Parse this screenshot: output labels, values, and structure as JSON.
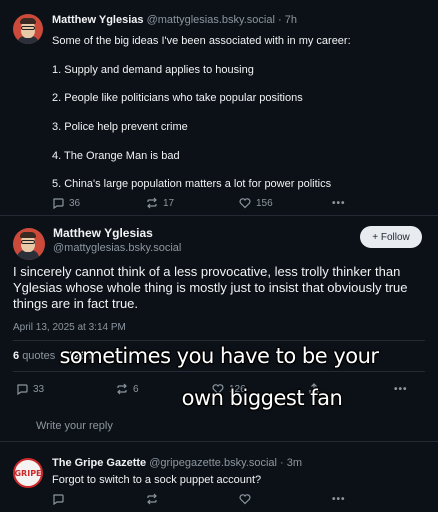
{
  "reply_post": {
    "author_name": "Matthew Yglesias",
    "author_handle": "@mattyglesias.bsky.social",
    "time": "7h",
    "intro": "Some of the big ideas I've been associated with in my career:",
    "items": [
      "1. Supply and demand applies to housing",
      "2. People like politicians who take popular positions",
      "3. Police help prevent crime",
      "4. The Orange Man is bad",
      "5. China's large population matters a lot for power politics"
    ],
    "reply_count": "36",
    "repost_count": "17",
    "like_count": "156",
    "more_label": "•••"
  },
  "main_post": {
    "author_name": "Matthew Yglesias",
    "author_handle": "@mattyglesias.bsky.social",
    "follow_label": "+ Follow",
    "text": "I sincerely cannot think of a less provocative, less trolly thinker than Yglesias whose whole thing is mostly just to insist that obviously true things are in fact true.",
    "date": "April 13, 2025 at 3:14 PM",
    "quotes_count": "6",
    "quotes_label": "quotes",
    "likes_count": "126",
    "likes_label_partial": "li",
    "reply_count": "33",
    "repost_count": "6",
    "like_count": "126",
    "more_label": "•••"
  },
  "meme_caption": {
    "line1": "sometimes you have to be your",
    "line2": "own biggest fan"
  },
  "composer": {
    "placeholder": "Write your reply"
  },
  "bottom_reply": {
    "author_name": "The Gripe Gazette",
    "author_handle": "@gripegazette.bsky.social",
    "time": "3m",
    "text": "Forgot to switch to a sock puppet account?",
    "avatar_label": "GRIPE",
    "more_label": "•••"
  },
  "colors": {
    "background": "#0c1117",
    "text": "#f1f3f5",
    "muted": "#8d96a0",
    "follow_button": "#e8ecf0"
  }
}
